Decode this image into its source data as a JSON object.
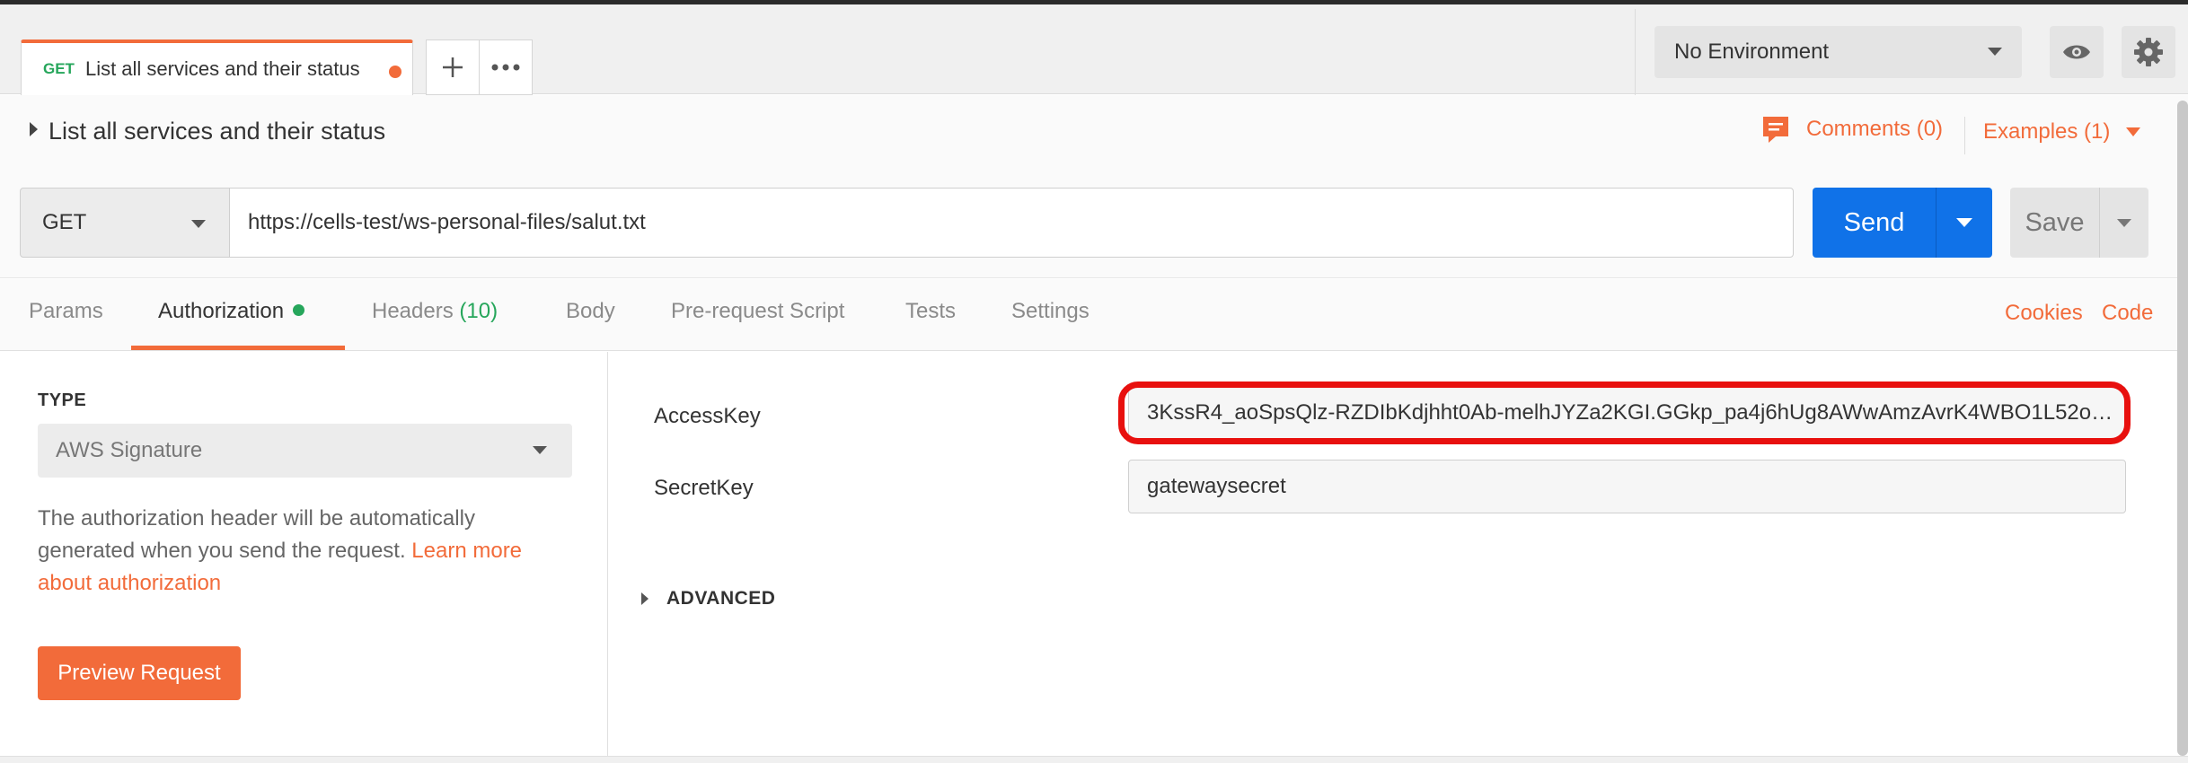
{
  "tab": {
    "method": "GET",
    "title": "List all services and their status"
  },
  "environment": {
    "selected": "No Environment"
  },
  "request": {
    "name": "List all services and their status",
    "method": "GET",
    "url": "https://cells-test/ws-personal-files/salut.txt"
  },
  "header_links": {
    "comments": "Comments (0)",
    "examples": "Examples (1)"
  },
  "buttons": {
    "send": "Send",
    "save": "Save",
    "preview": "Preview Request"
  },
  "subtabs": {
    "params": "Params",
    "authorization": "Authorization",
    "headers": "Headers",
    "headers_count": "(10)",
    "body": "Body",
    "prerequest": "Pre-request Script",
    "tests": "Tests",
    "settings": "Settings",
    "cookies": "Cookies",
    "code": "Code"
  },
  "auth": {
    "type_label": "TYPE",
    "type_value": "AWS Signature",
    "description": "The authorization header will be automatically generated when you send the request. ",
    "learn_more": "Learn more about authorization",
    "access_key_label": "AccessKey",
    "access_key_value": "3KssR4_aoSpsQlz-RZDIbKdjhht0Ab-melhJYZa2KGI.GGkp_pa4j6hUg8AWwAmzAvrK4WBO1L52o…",
    "secret_key_label": "SecretKey",
    "secret_key_value": "gatewaysecret",
    "advanced": "ADVANCED"
  },
  "colors": {
    "accent": "#f26b3a",
    "send": "#1072e8",
    "get": "#26a65b",
    "highlight": "#e8100e"
  }
}
